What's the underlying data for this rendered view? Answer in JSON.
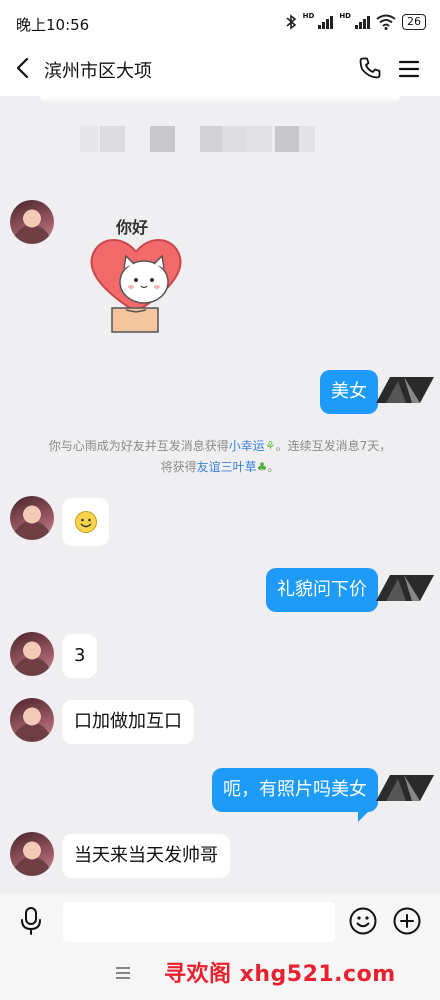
{
  "status_bar": {
    "time": "晚上10:56",
    "signal1_label": "HD",
    "signal2_label": "HD",
    "battery": "26"
  },
  "header": {
    "title": "滨州市区大项"
  },
  "messages": {
    "m1_sticker_text": "你好",
    "m2": "美女",
    "m4": "礼貌问下价",
    "m5": "3",
    "m6": "口加做加互口",
    "m7": "呃，有照片吗美女",
    "m8": "当天来当天发帅哥"
  },
  "system_notice": {
    "line1_pre": "你与心雨成为好友并互发消息获得",
    "line1_link": "小幸运",
    "line1_post": "。连续互发消息7天，",
    "line2_pre": "将获得",
    "line2_link": "友谊三叶草",
    "line2_post": "。"
  },
  "watermark": "寻欢阁 xhg521.com",
  "colors": {
    "accent_blue": "#1e9bf8",
    "link_blue": "#3b82d6",
    "watermark_red": "#e8212e",
    "background": "#efeff2"
  },
  "icons": [
    "bluetooth-icon",
    "signal-icon",
    "wifi-icon",
    "battery-icon",
    "back-icon",
    "phone-icon",
    "menu-icon",
    "mic-icon",
    "emoji-icon",
    "plus-icon"
  ]
}
